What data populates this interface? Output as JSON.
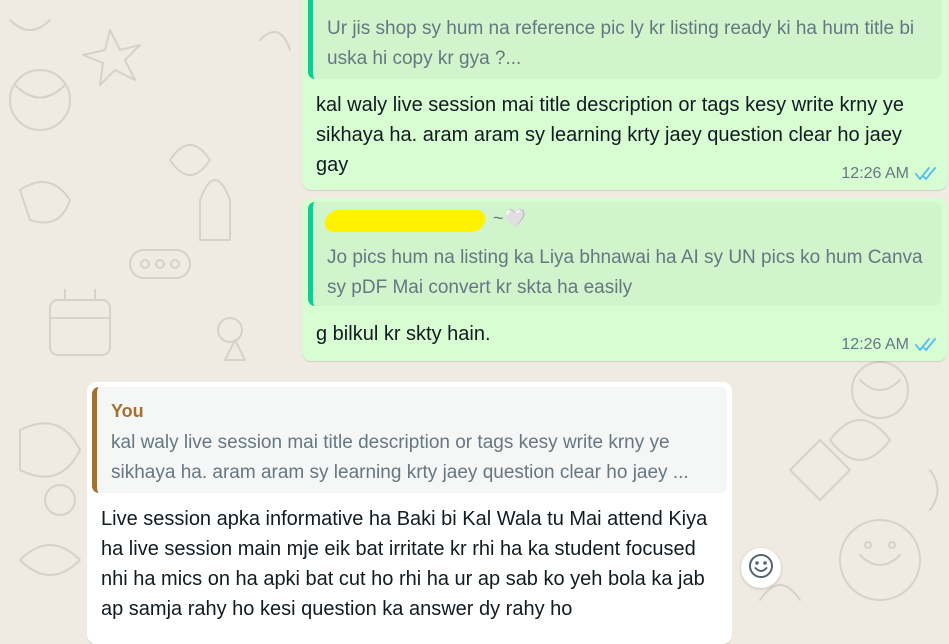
{
  "chat": {
    "messages": [
      {
        "quote": {
          "text": "Ur jis shop sy hum na reference pic ly kr listing ready ki ha hum title bi uska hi copy kr gya ?..."
        },
        "text": "kal waly live session mai title description or tags kesy write krny ye sikhaya ha. aram aram sy learning krty jaey question clear ho jaey gay",
        "time": "12:26 AM",
        "status_icon": "double-check-icon"
      },
      {
        "quote": {
          "author_suffix": "~🤍",
          "text": "Jo pics hum na listing ka Liya bhnawai ha AI sy UN pics ko hum Canva sy pDF Mai convert kr skta ha easily"
        },
        "text": "g bilkul kr skty hain.",
        "time": "12:26 AM",
        "status_icon": "double-check-icon"
      },
      {
        "quote": {
          "author": "You",
          "text": "kal waly live session mai title description or tags kesy write krny ye sikhaya ha. aram aram sy learning krty jaey question clear ho jaey ..."
        },
        "text": "Live session apka informative ha Baki bi Kal Wala tu Mai attend Kiya ha live session main mje eik bat irritate kr rhi ha ka student focused nhi ha mics on ha apki bat cut ho rhi ha ur ap sab ko yeh bola ka jab ap samja rahy ho kesi question ka answer dy rahy ho"
      }
    ],
    "emoji_button_icon": "smiley-icon"
  },
  "colors": {
    "background": "#efeae2",
    "outgoing_bubble": "#d9fdd3",
    "incoming_bubble": "#ffffff",
    "read_tick": "#53bdeb",
    "reply_author_you": "#a5712e",
    "quote_bar": "#06cf9c"
  }
}
